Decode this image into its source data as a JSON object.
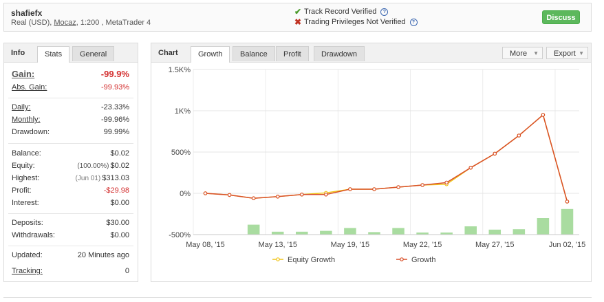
{
  "header": {
    "name": "shafiefx",
    "sub_prefix": "Real (USD), ",
    "broker": "Mocaz",
    "sub_suffix": ", 1:200 , MetaTrader 4",
    "verify1": "Track Record Verified",
    "verify2": "Trading Privileges Not Verified",
    "discuss": "Discuss"
  },
  "info": {
    "title": "Info",
    "tabs": [
      "Stats",
      "General"
    ],
    "gain_label": "Gain:",
    "gain_value": "-99.9%",
    "abs_gain_label": "Abs. Gain:",
    "abs_gain_value": "-99.93%",
    "daily_label": "Daily:",
    "daily_value": "-23.33%",
    "monthly_label": "Monthly:",
    "monthly_value": "-99.96%",
    "drawdown_label": "Drawdown:",
    "drawdown_value": "99.99%",
    "balance_label": "Balance:",
    "balance_value": "$0.02",
    "equity_label": "Equity:",
    "equity_pct": "(100.00%)",
    "equity_value": "$0.02",
    "highest_label": "Highest:",
    "highest_date": "(Jun 01)",
    "highest_value": "$313.03",
    "profit_label": "Profit:",
    "profit_value": "-$29.98",
    "interest_label": "Interest:",
    "interest_value": "$0.00",
    "deposits_label": "Deposits:",
    "deposits_value": "$30.00",
    "withdrawals_label": "Withdrawals:",
    "withdrawals_value": "$0.00",
    "updated_label": "Updated:",
    "updated_value": "20 Minutes ago",
    "tracking_label": "Tracking:",
    "tracking_value": "0"
  },
  "chart_panel": {
    "title": "Chart",
    "tabs": [
      "Growth",
      "Balance",
      "Profit",
      "Drawdown"
    ],
    "more": "More",
    "export": "Export"
  },
  "chart_data": {
    "type": "line",
    "ylim": [
      -500,
      1500
    ],
    "ytick_values": [
      -500,
      0,
      500,
      1000,
      1500
    ],
    "ytick_labels": [
      "-500%",
      "0%",
      "500%",
      "1K%",
      "1.5K%"
    ],
    "xtick_labels": [
      "May 08, '15",
      "May 13, '15",
      "May 19, '15",
      "May 22, '15",
      "May 27, '15",
      "Jun 02, '15"
    ],
    "xtick_index": [
      0,
      3,
      6,
      9,
      12,
      15
    ],
    "grid": true,
    "legend_position": "bottom",
    "series": [
      {
        "name": "Equity Growth",
        "color": "#f0c419",
        "values": [
          0,
          -20,
          -60,
          -40,
          -15,
          5,
          50,
          50,
          75,
          100,
          110,
          310,
          480,
          700,
          950,
          -100
        ]
      },
      {
        "name": "Growth",
        "color": "#d9502a",
        "values": [
          0,
          -20,
          -60,
          -40,
          -15,
          -15,
          50,
          50,
          75,
          100,
          130,
          310,
          480,
          700,
          950,
          -100
        ]
      }
    ],
    "bars": {
      "color": "#a9dca0",
      "values": [
        0,
        0,
        120,
        35,
        35,
        45,
        80,
        30,
        80,
        25,
        25,
        100,
        60,
        65,
        200,
        310
      ]
    }
  }
}
